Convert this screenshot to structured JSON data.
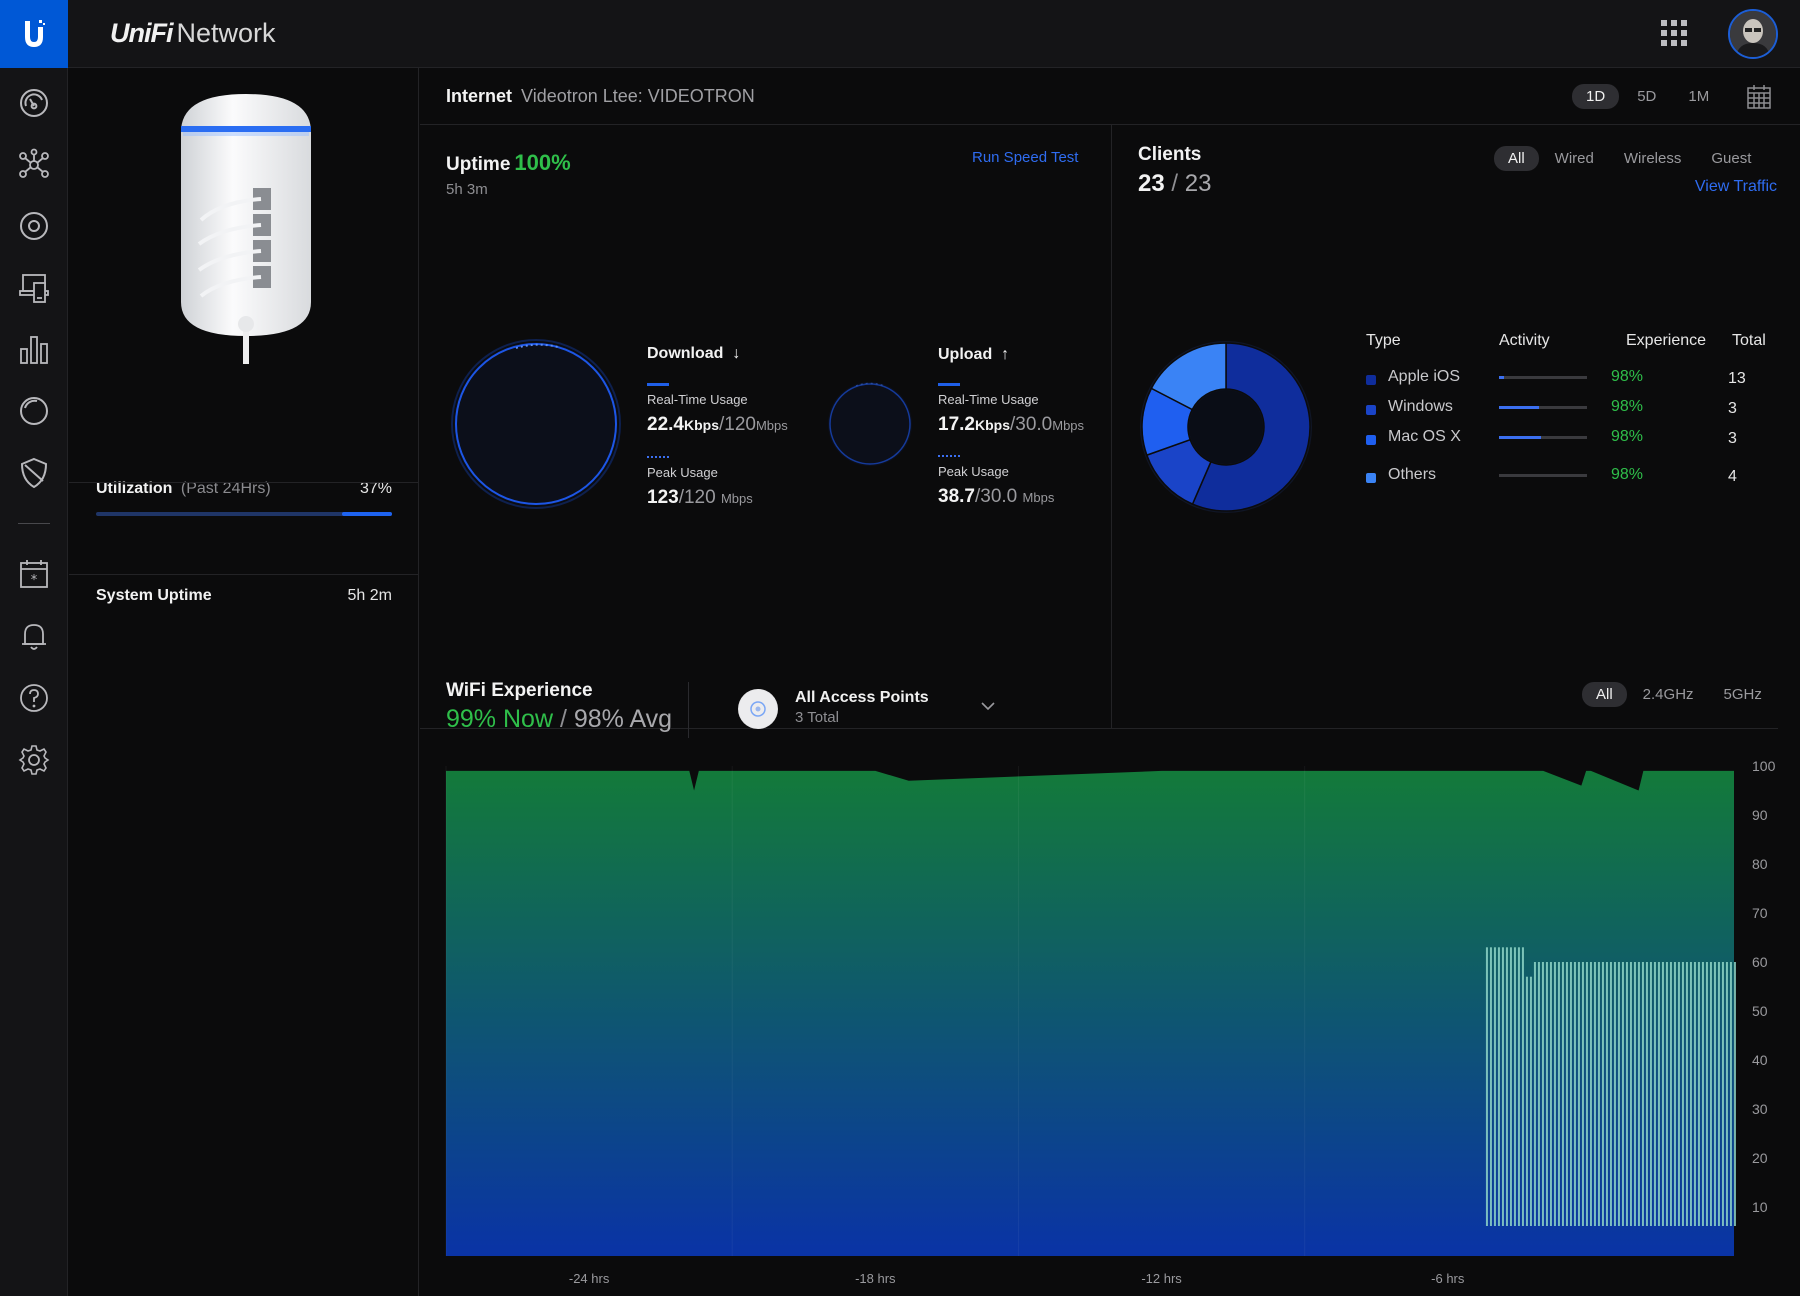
{
  "app": {
    "brand_italic": "UniFi",
    "brand_rest": "Network"
  },
  "sidebar": {
    "items": [
      {
        "name": "dashboard-icon"
      },
      {
        "name": "topology-icon"
      },
      {
        "name": "devices-icon"
      },
      {
        "name": "clients-icon"
      },
      {
        "name": "statistics-icon"
      },
      {
        "name": "insights-icon"
      },
      {
        "name": "threat-shield-icon"
      },
      {
        "name": "events-calendar-icon"
      },
      {
        "name": "alerts-bell-icon"
      },
      {
        "name": "help-icon"
      },
      {
        "name": "settings-gear-icon"
      }
    ]
  },
  "device": {
    "utilization_label": "Utilization",
    "utilization_sub": "(Past 24Hrs)",
    "utilization_value": "37%",
    "utilization_fraction": 0.17,
    "system_uptime_label": "System Uptime",
    "system_uptime_value": "5h 2m"
  },
  "internet": {
    "label": "Internet",
    "isp": "Videotron Ltee: VIDEOTRON",
    "ranges": [
      "1D",
      "5D",
      "1M"
    ],
    "active_range": "1D"
  },
  "uptime": {
    "label": "Uptime",
    "percent": "100%",
    "duration": "5h 3m",
    "speed_test": "Run Speed Test"
  },
  "download": {
    "label": "Download",
    "arrow": "↓",
    "realtime_label": "Real-Time Usage",
    "realtime_value": "22.4",
    "realtime_unit": "Kbps",
    "realtime_max": "120",
    "realtime_max_unit": "Mbps",
    "peak_label": "Peak Usage",
    "peak_value": "123",
    "peak_max": "120",
    "peak_unit": "Mbps"
  },
  "upload": {
    "label": "Upload",
    "arrow": "↑",
    "realtime_label": "Real-Time Usage",
    "realtime_value": "17.2",
    "realtime_unit": "Kbps",
    "realtime_max": "30.0",
    "realtime_max_unit": "Mbps",
    "peak_label": "Peak Usage",
    "peak_value": "38.7",
    "peak_max": "30.0",
    "peak_unit": "Mbps"
  },
  "clients": {
    "title": "Clients",
    "count": "23",
    "slash": "/",
    "total": "23",
    "tabs": [
      "All",
      "Wired",
      "Wireless",
      "Guest"
    ],
    "active_tab": "All",
    "view_traffic": "View Traffic",
    "columns": [
      "Type",
      "Activity",
      "Experience",
      "Total"
    ],
    "rows": [
      {
        "type": "Apple iOS",
        "activity": 0.06,
        "experience": "98%",
        "total": "13",
        "color": "#0f2d9c"
      },
      {
        "type": "Windows",
        "activity": 0.45,
        "experience": "98%",
        "total": "3",
        "color": "#1a44c8"
      },
      {
        "type": "Mac OS X",
        "activity": 0.48,
        "experience": "98%",
        "total": "3",
        "color": "#1f5ff0"
      },
      {
        "type": "Others",
        "activity": 0.0,
        "experience": "98%",
        "total": "4",
        "color": "#3a83f5"
      }
    ]
  },
  "wifi": {
    "title": "WiFi Experience",
    "now": "99% Now",
    "sep": " / ",
    "avg": "98% Avg",
    "ap_title": "All Access Points",
    "ap_sub": "3 Total",
    "bands": [
      "All",
      "2.4GHz",
      "5GHz"
    ],
    "active_band": "All"
  },
  "chart_data": {
    "type": "area",
    "title": "",
    "ylim": [
      0,
      100
    ],
    "y_ticks": [
      "100",
      "90",
      "80",
      "70",
      "60",
      "50",
      "40",
      "30",
      "20",
      "10"
    ],
    "x_ticks": [
      "-24 hrs",
      "-18 hrs",
      "-12 hrs",
      "-6 hrs"
    ],
    "series": [
      {
        "values_note_free": true,
        "x": [
          -27,
          -24,
          -21.9,
          -21.8,
          -21.7,
          -18,
          -17.3,
          -12,
          -9,
          -6,
          -4,
          -3.2,
          -3.1,
          -3.0,
          -2.0,
          -1.9,
          0
        ],
        "y": [
          99,
          99,
          99,
          95,
          99,
          99,
          97,
          99,
          99,
          99,
          99,
          96,
          99,
          99,
          95,
          99,
          99
        ]
      },
      {
        "name_free": true,
        "x_start": -5.2,
        "x_end": 0,
        "levels": [
          {
            "x0": -5.2,
            "x1": -4.4,
            "y": 63
          },
          {
            "x0": -4.4,
            "x1": -4.2,
            "y": 57
          },
          {
            "x0": -4.2,
            "x1": 0,
            "y": 60
          }
        ]
      }
    ],
    "colors": {
      "fill_top": "#137a3a",
      "fill_bottom": "#0a33a6",
      "bars": "#8fd6c8"
    }
  }
}
